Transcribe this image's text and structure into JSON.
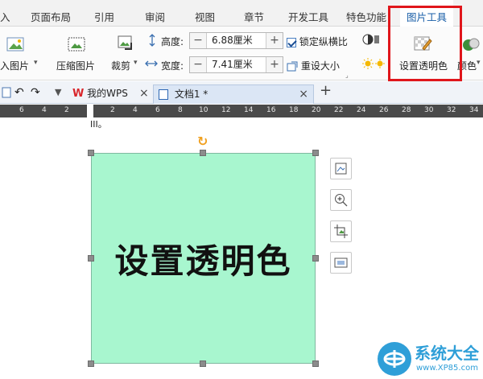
{
  "tabs": [
    {
      "label": "入"
    },
    {
      "label": "页面布局"
    },
    {
      "label": "引用"
    },
    {
      "label": "审阅"
    },
    {
      "label": "视图"
    },
    {
      "label": "章节"
    },
    {
      "label": "开发工具"
    },
    {
      "label": "特色功能"
    },
    {
      "label": "图片工具"
    }
  ],
  "ribbon": {
    "insert_picture": "入图片",
    "compress_picture": "压缩图片",
    "crop": "裁剪",
    "height_label": "高度:",
    "height_value": "6.88厘米",
    "width_label": "宽度:",
    "width_value": "7.41厘米",
    "lock_ratio": "锁定纵横比",
    "reset_size": "重设大小",
    "set_transparent": "设置透明色",
    "color": "颜色"
  },
  "doc_tabs": {
    "wps_tab": "我的WPS",
    "doc_tab": "文档1 *"
  },
  "ruler": [
    "6",
    "4",
    "2",
    "2",
    "4",
    "6",
    "8",
    "10",
    "12",
    "14",
    "16",
    "18",
    "20",
    "22",
    "24",
    "26",
    "28",
    "30",
    "32",
    "34"
  ],
  "document": {
    "cursor_text": "III。",
    "picture_text": "设置透明色"
  },
  "watermark": {
    "name": "系统大全",
    "url": "www.XP85.com"
  },
  "colors": {
    "picture_fill": "#a8f6cf",
    "highlight_border": "#e0161b",
    "active_tab_text": "#1a5fa8"
  }
}
